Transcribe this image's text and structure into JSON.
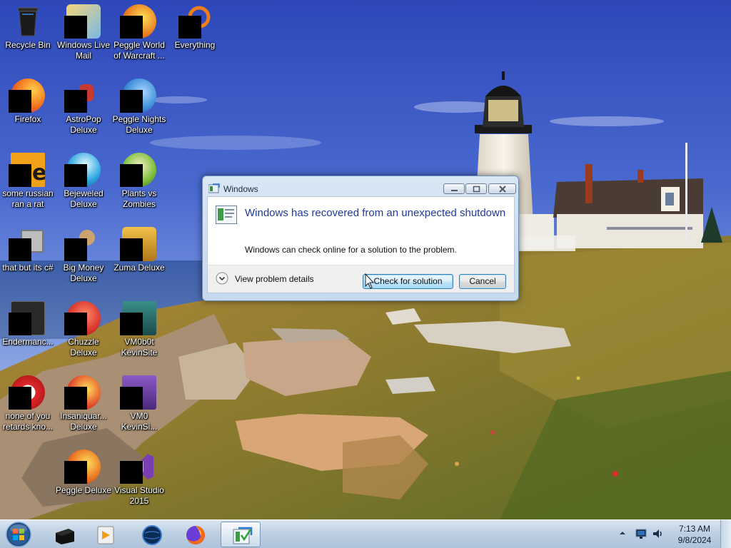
{
  "desktop": {
    "icons": [
      {
        "label": "Recycle Bin",
        "icon": "recycle-bin-icon",
        "color": "#1a1a1a"
      },
      {
        "label": "Windows Live\nMail",
        "icon": "windows-live-mail-icon",
        "color": "#e5b84a"
      },
      {
        "label": "Peggle World\nof Warcraft ...",
        "icon": "peggle-world-of-warcraft-icon",
        "color": "#e8781e"
      },
      {
        "label": "Everything",
        "icon": "everything-search-icon",
        "color": "#f07d1a"
      },
      {
        "label": "Firefox",
        "icon": "firefox-icon",
        "color": "#f26b1d"
      },
      {
        "label": "AstroPop\nDeluxe",
        "icon": "astropop-deluxe-icon",
        "color": "#c83a2f"
      },
      {
        "label": "Peggle Nights\nDeluxe",
        "icon": "peggle-nights-deluxe-icon",
        "color": "#3d8fd8"
      },
      {
        "label": "some russian\nran a rat",
        "icon": "java-app-icon",
        "color": "#f1a11a"
      },
      {
        "label": "Bejeweled\nDeluxe",
        "icon": "bejeweled-deluxe-icon",
        "color": "#2fa7e0"
      },
      {
        "label": "Plants vs\nZombies",
        "icon": "plants-vs-zombies-icon",
        "color": "#7dbd3a"
      },
      {
        "label": "that but its c#",
        "icon": "csharp-app-icon",
        "color": "#9c9c9c"
      },
      {
        "label": "Big Money\nDeluxe",
        "icon": "big-money-deluxe-icon",
        "color": "#c9a36b"
      },
      {
        "label": "Zuma Deluxe",
        "icon": "zuma-deluxe-icon",
        "color": "#d89a25"
      },
      {
        "label": "Endermanc...",
        "icon": "endermanch-icon",
        "color": "#333333"
      },
      {
        "label": "Chuzzle\nDeluxe",
        "icon": "chuzzle-deluxe-icon",
        "color": "#d8322a"
      },
      {
        "label": "VM0b0t\nKevinSite",
        "icon": "vm0b0t-kevinsite-icon",
        "color": "#2a6f6a"
      },
      {
        "label": "none of you\nretards kno...",
        "icon": "opera-icon",
        "color": "#e0282b"
      },
      {
        "label": "Insaniquar...\nDeluxe",
        "icon": "insaniquarium-deluxe-icon",
        "color": "#e0482a"
      },
      {
        "label": "VM0\nKevinSi...",
        "icon": "vm0-kevinsite-icon",
        "color": "#6b3aa3"
      },
      {
        "label": "Peggle Deluxe",
        "icon": "peggle-deluxe-icon",
        "color": "#e86a1e"
      },
      {
        "label": "Visual Studio\n2015",
        "icon": "visual-studio-2015-icon",
        "color": "#7b3fb3"
      }
    ]
  },
  "dialog": {
    "title": "Windows",
    "heading": "Windows has recovered from an unexpected shutdown",
    "subtext": "Windows can check online for a solution to the problem.",
    "details_label": "View problem details",
    "check_button": "Check for solution",
    "cancel_button": "Cancel"
  },
  "taskbar": {
    "apps": [
      {
        "icon": "start-orb-icon"
      },
      {
        "icon": "terminal-app-icon"
      },
      {
        "icon": "media-player-icon"
      },
      {
        "icon": "globe-browser-icon"
      },
      {
        "icon": "firefox-icon"
      },
      {
        "icon": "windows-error-reporting-icon",
        "active": true
      }
    ],
    "tray": {
      "time": "7:13 AM",
      "date": "9/8/2024"
    }
  }
}
